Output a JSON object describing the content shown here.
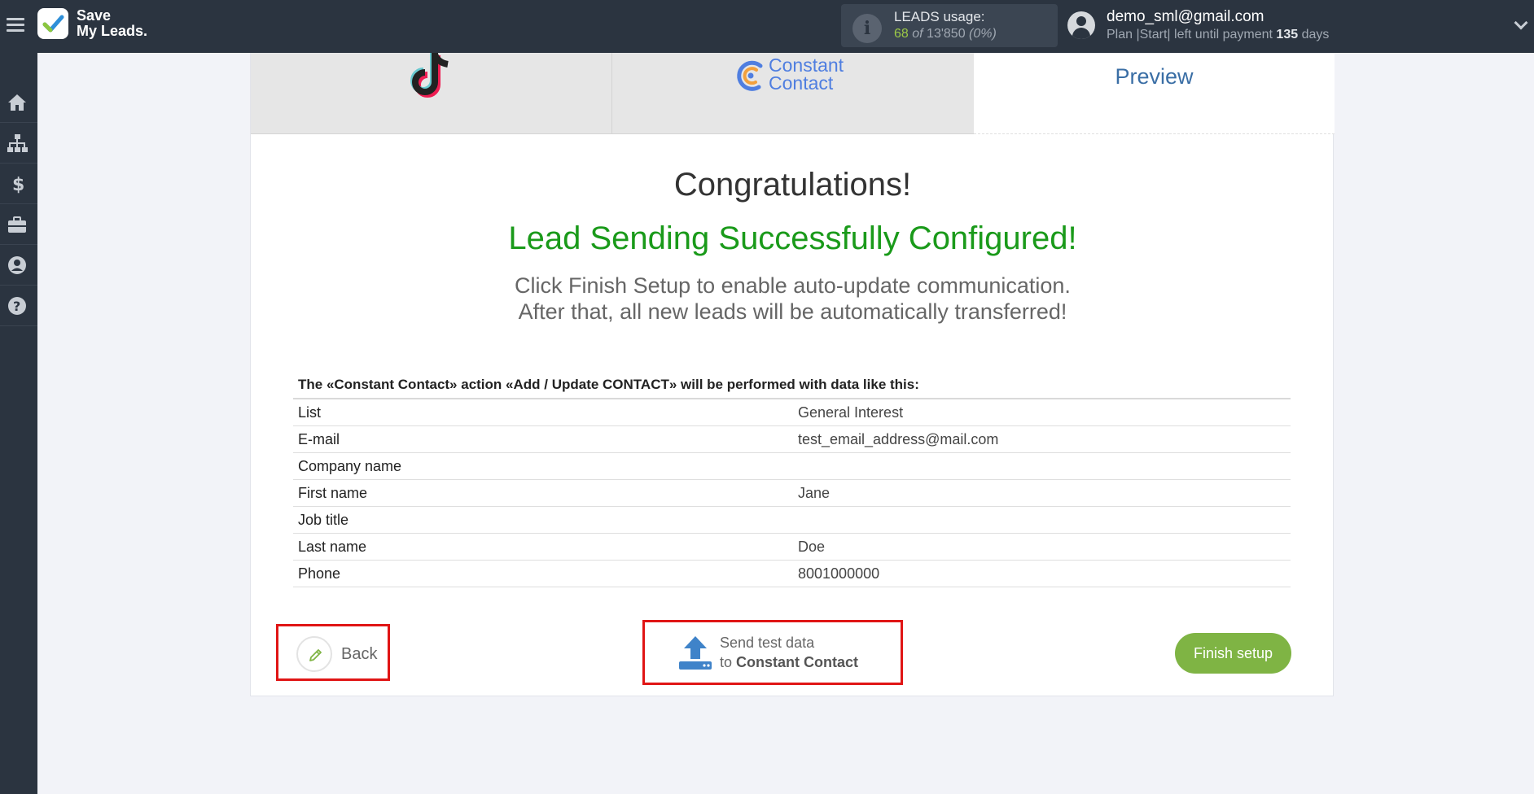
{
  "app": {
    "logo_line1": "Save",
    "logo_line2": "My Leads."
  },
  "usage": {
    "label": "LEADS usage:",
    "used": "68",
    "of": "of",
    "total": "13'850",
    "percent": "(0%)"
  },
  "user": {
    "email": "demo_sml@gmail.com",
    "plan_text": "Plan |Start| left until payment",
    "days": "135",
    "days_unit": "days"
  },
  "sidebar": {
    "items": [
      "home-icon",
      "sitemap-icon",
      "dollar-icon",
      "briefcase-icon",
      "user-circle-icon",
      "question-icon"
    ]
  },
  "tabs": {
    "source_icon": "tiktok-logo",
    "destination_line1": "Constant",
    "destination_line2": "Contact",
    "preview": "Preview"
  },
  "main": {
    "congrats": "Congratulations!",
    "success": "Lead Sending Successfully Configured!",
    "desc_line1": "Click Finish Setup to enable auto-update communication.",
    "desc_line2": "After that, all new leads will be automatically transferred!",
    "table_caption": "The «Constant Contact» action «Add / Update CONTACT» will be performed with data like this:",
    "rows": [
      {
        "key": "List",
        "value": "General Interest"
      },
      {
        "key": "E-mail",
        "value": "test_email_address@mail.com"
      },
      {
        "key": "Company name",
        "value": ""
      },
      {
        "key": "First name",
        "value": "Jane"
      },
      {
        "key": "Job title",
        "value": ""
      },
      {
        "key": "Last name",
        "value": "Doe"
      },
      {
        "key": "Phone",
        "value": "8001000000"
      }
    ]
  },
  "buttons": {
    "back": "Back",
    "send_line1": "Send test data",
    "send_to": "to",
    "send_target": "Constant Contact",
    "finish": "Finish setup"
  },
  "colors": {
    "topbar": "#2b3440",
    "success_green": "#1a9a1a",
    "finish_green": "#7fb444",
    "highlight_red": "#e01515",
    "preview_blue": "#3a6ea5"
  }
}
